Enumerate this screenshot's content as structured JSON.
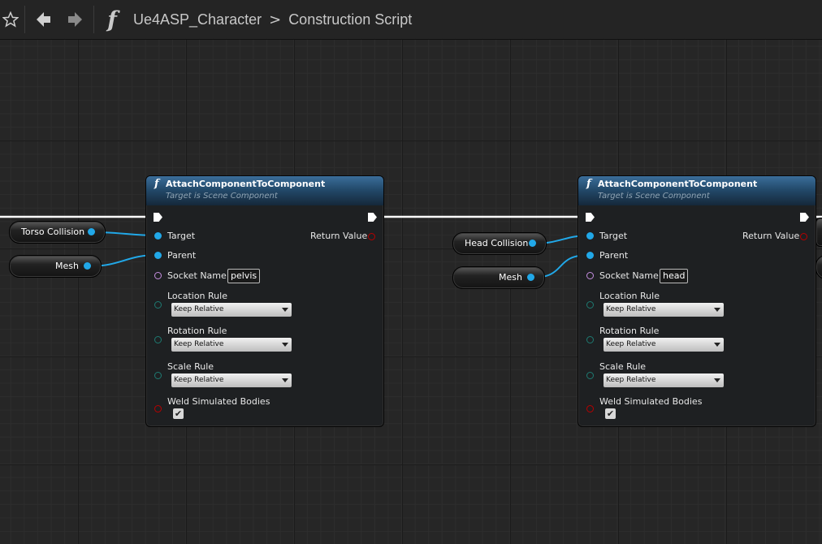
{
  "toolbar": {
    "function_glyph": "f",
    "breadcrumb": [
      "Ue4ASP_Character",
      "Construction Script"
    ],
    "breadcrumb_separator": ">",
    "icons": [
      "star-icon",
      "back-arrow-icon",
      "forward-arrow-icon"
    ]
  },
  "colors": {
    "object_pin": "#21a8e8",
    "name_pin": "#c58ee0",
    "enum_pin": "#1e7a72",
    "bool_pin": "#b80000",
    "exec_wire": "#ffffff",
    "node_header": "#2d5a82"
  },
  "nodes": [
    {
      "glyph": "f",
      "title": "AttachComponentToComponent",
      "subtitle": "Target is Scene Component",
      "pins": {
        "target": "Target",
        "parent": "Parent",
        "socket_name": "Socket Name",
        "socket_value": "pelvis",
        "return_value": "Return Value",
        "location_rule": "Location Rule",
        "location_value": "Keep Relative",
        "rotation_rule": "Rotation Rule",
        "rotation_value": "Keep Relative",
        "scale_rule": "Scale Rule",
        "scale_value": "Keep Relative",
        "weld": "Weld Simulated Bodies",
        "weld_checked": true
      }
    },
    {
      "glyph": "f",
      "title": "AttachComponentToComponent",
      "subtitle": "Target is Scene Component",
      "pins": {
        "target": "Target",
        "parent": "Parent",
        "socket_name": "Socket Name",
        "socket_value": "head",
        "return_value": "Return Value",
        "location_rule": "Location Rule",
        "location_value": "Keep Relative",
        "rotation_rule": "Rotation Rule",
        "rotation_value": "Keep Relative",
        "scale_rule": "Scale Rule",
        "scale_value": "Keep Relative",
        "weld": "Weld Simulated Bodies",
        "weld_checked": true
      }
    }
  ],
  "variables": [
    {
      "label": "Torso Collision"
    },
    {
      "label": "Mesh"
    },
    {
      "label": "Head Collision"
    },
    {
      "label": "Mesh"
    }
  ]
}
